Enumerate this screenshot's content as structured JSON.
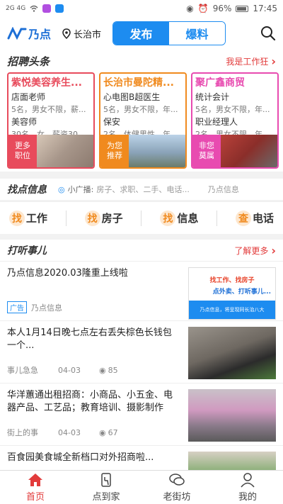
{
  "statusbar": {
    "signal_left": "2G 4G",
    "battery": "96%",
    "time": "17:45"
  },
  "header": {
    "logo_text": "乃点",
    "location": "长治市",
    "seg_publish": "发布",
    "seg_report": "爆料"
  },
  "hiring": {
    "title": "招聘头条",
    "more": "我是工作狂",
    "cards": [
      {
        "name": "紫悦美容养生...",
        "lines": [
          "店面老师",
          "5名，男女不限，薪...",
          "美容师",
          "30名，女，薪资30..."
        ],
        "tag": "更多职位",
        "color": "#e84b5c"
      },
      {
        "name": "长治市曼陀精...",
        "lines": [
          "心电图B超医生",
          "5名，男女不限，年...",
          "保安",
          "2名，体健男性，年..."
        ],
        "tag": "为您推荐",
        "color": "#f08a1e"
      },
      {
        "name": "聚广鑫商贸",
        "lines": [
          "统计会计",
          "5名，男女不限，年...",
          "职业经理人",
          "2名，男女不限，年..."
        ],
        "tag": "非您莫属",
        "color": "#e84bb0"
      }
    ]
  },
  "find": {
    "title": "找点信息",
    "broadcast_label": "小广播:",
    "broadcast_text": "房子、求职、二手、电话...",
    "tail": "乃点信息",
    "buttons": [
      {
        "c": "找",
        "t": "工作"
      },
      {
        "c": "找",
        "t": "房子"
      },
      {
        "c": "找",
        "t": "信息"
      },
      {
        "c": "查",
        "t": "电话"
      }
    ]
  },
  "listen": {
    "title": "打听事儿",
    "more": "了解更多",
    "items": [
      {
        "title": "乃点信息2020.03隆重上线啦",
        "ad": "广告",
        "source": "乃点信息",
        "date": "",
        "views": "",
        "thumb_lines": [
          "找工作、找房子",
          "点外卖、打听事儿..."
        ],
        "thumb_foot": "乃点信息，将呈现同长治八大"
      },
      {
        "title": "本人1月14日晚七点左右丢失棕色长钱包一个...",
        "ad": "",
        "source": "事儿急急",
        "date": "04-03",
        "views": "85"
      },
      {
        "title": "华洋蕙通出租招商：小商品、小五金、电器产品、工艺品；教育培训、摄影制作",
        "ad": "",
        "source": "街上的事",
        "date": "04-03",
        "views": "67"
      },
      {
        "title": "百食园美食城全新档口对外招商啦...",
        "ad": "",
        "source": "",
        "date": "",
        "views": ""
      }
    ]
  },
  "tabs": [
    {
      "label": "首页",
      "active": true
    },
    {
      "label": "点到家",
      "active": false
    },
    {
      "label": "老街坊",
      "active": false
    },
    {
      "label": "我的",
      "active": false
    }
  ]
}
